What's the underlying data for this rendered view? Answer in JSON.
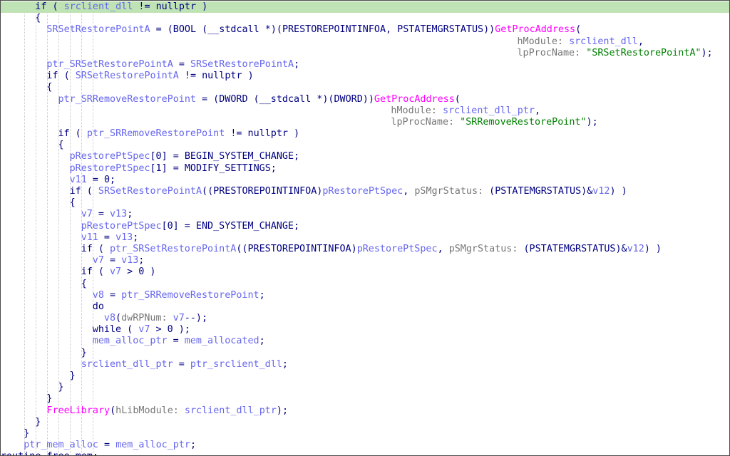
{
  "theme": {
    "highlight_bg": "#bfe3b4",
    "plain": "#000080",
    "var": "#6666ee",
    "func": "#ff00ff",
    "str": "#008000",
    "param_label": "#777777"
  },
  "code": {
    "highlighted_line": 0,
    "lines": [
      {
        "indent": 6,
        "tokens": [
          {
            "t": "k",
            "x": "if ( "
          },
          {
            "t": "v",
            "x": "srclient_dll"
          },
          {
            "t": "p",
            "x": " != nullptr )"
          }
        ]
      },
      {
        "indent": 6,
        "tokens": [
          {
            "t": "p",
            "x": "{"
          }
        ]
      },
      {
        "indent": 8,
        "tokens": [
          {
            "t": "v",
            "x": "SRSetRestorePointA"
          },
          {
            "t": "p",
            "x": " = (BOOL (__stdcall *)(PRESTOREPOINTINFOA, PSTATEMGRSTATUS))"
          },
          {
            "t": "f",
            "x": "GetProcAddress"
          },
          {
            "t": "p",
            "x": "("
          }
        ]
      },
      {
        "indent": 90,
        "tokens": [
          {
            "t": "pl",
            "x": "hModule: "
          },
          {
            "t": "v",
            "x": "srclient_dll"
          },
          {
            "t": "p",
            "x": ","
          }
        ]
      },
      {
        "indent": 90,
        "tokens": [
          {
            "t": "pl",
            "x": "lpProcName: "
          },
          {
            "t": "s",
            "x": "\"SRSetRestorePointA\""
          },
          {
            "t": "p",
            "x": ");"
          }
        ]
      },
      {
        "indent": 8,
        "tokens": [
          {
            "t": "v",
            "x": "ptr_SRSetRestorePointA"
          },
          {
            "t": "p",
            "x": " = "
          },
          {
            "t": "v",
            "x": "SRSetRestorePointA"
          },
          {
            "t": "p",
            "x": ";"
          }
        ]
      },
      {
        "indent": 8,
        "tokens": [
          {
            "t": "k",
            "x": "if ( "
          },
          {
            "t": "v",
            "x": "SRSetRestorePointA"
          },
          {
            "t": "p",
            "x": " != nullptr )"
          }
        ]
      },
      {
        "indent": 8,
        "tokens": [
          {
            "t": "p",
            "x": "{"
          }
        ]
      },
      {
        "indent": 10,
        "tokens": [
          {
            "t": "v",
            "x": "ptr_SRRemoveRestorePoint"
          },
          {
            "t": "p",
            "x": " = (DWORD (__stdcall *)(DWORD))"
          },
          {
            "t": "f",
            "x": "GetProcAddress"
          },
          {
            "t": "p",
            "x": "("
          }
        ]
      },
      {
        "indent": 68,
        "tokens": [
          {
            "t": "pl",
            "x": "hModule: "
          },
          {
            "t": "v",
            "x": "srclient_dll_ptr"
          },
          {
            "t": "p",
            "x": ","
          }
        ]
      },
      {
        "indent": 68,
        "tokens": [
          {
            "t": "pl",
            "x": "lpProcName: "
          },
          {
            "t": "s",
            "x": "\"SRRemoveRestorePoint\""
          },
          {
            "t": "p",
            "x": ");"
          }
        ]
      },
      {
        "indent": 10,
        "tokens": [
          {
            "t": "k",
            "x": "if ( "
          },
          {
            "t": "v",
            "x": "ptr_SRRemoveRestorePoint"
          },
          {
            "t": "p",
            "x": " != nullptr )"
          }
        ]
      },
      {
        "indent": 10,
        "tokens": [
          {
            "t": "p",
            "x": "{"
          }
        ]
      },
      {
        "indent": 12,
        "tokens": [
          {
            "t": "v",
            "x": "pRestorePtSpec"
          },
          {
            "t": "p",
            "x": "[0] = BEGIN_SYSTEM_CHANGE;"
          }
        ]
      },
      {
        "indent": 12,
        "tokens": [
          {
            "t": "v",
            "x": "pRestorePtSpec"
          },
          {
            "t": "p",
            "x": "[1] = MODIFY_SETTINGS;"
          }
        ]
      },
      {
        "indent": 12,
        "tokens": [
          {
            "t": "v",
            "x": "v11"
          },
          {
            "t": "p",
            "x": " = 0;"
          }
        ]
      },
      {
        "indent": 12,
        "tokens": [
          {
            "t": "k",
            "x": "if ( "
          },
          {
            "t": "v",
            "x": "SRSetRestorePointA"
          },
          {
            "t": "p",
            "x": "((PRESTOREPOINTINFOA)"
          },
          {
            "t": "v",
            "x": "pRestorePtSpec"
          },
          {
            "t": "p",
            "x": ", "
          },
          {
            "t": "pl",
            "x": "pSMgrStatus: "
          },
          {
            "t": "p",
            "x": "(PSTATEMGRSTATUS)&"
          },
          {
            "t": "v",
            "x": "v12"
          },
          {
            "t": "p",
            "x": ") )"
          }
        ]
      },
      {
        "indent": 12,
        "tokens": [
          {
            "t": "p",
            "x": "{"
          }
        ]
      },
      {
        "indent": 14,
        "tokens": [
          {
            "t": "v",
            "x": "v7"
          },
          {
            "t": "p",
            "x": " = "
          },
          {
            "t": "v",
            "x": "v13"
          },
          {
            "t": "p",
            "x": ";"
          }
        ]
      },
      {
        "indent": 14,
        "tokens": [
          {
            "t": "v",
            "x": "pRestorePtSpec"
          },
          {
            "t": "p",
            "x": "[0] = END_SYSTEM_CHANGE;"
          }
        ]
      },
      {
        "indent": 14,
        "tokens": [
          {
            "t": "v",
            "x": "v11"
          },
          {
            "t": "p",
            "x": " = "
          },
          {
            "t": "v",
            "x": "v13"
          },
          {
            "t": "p",
            "x": ";"
          }
        ]
      },
      {
        "indent": 14,
        "tokens": [
          {
            "t": "k",
            "x": "if ( "
          },
          {
            "t": "v",
            "x": "ptr_SRSetRestorePointA"
          },
          {
            "t": "p",
            "x": "((PRESTOREPOINTINFOA)"
          },
          {
            "t": "v",
            "x": "pRestorePtSpec"
          },
          {
            "t": "p",
            "x": ", "
          },
          {
            "t": "pl",
            "x": "pSMgrStatus: "
          },
          {
            "t": "p",
            "x": "(PSTATEMGRSTATUS)&"
          },
          {
            "t": "v",
            "x": "v12"
          },
          {
            "t": "p",
            "x": ") )"
          }
        ]
      },
      {
        "indent": 16,
        "tokens": [
          {
            "t": "v",
            "x": "v7"
          },
          {
            "t": "p",
            "x": " = "
          },
          {
            "t": "v",
            "x": "v13"
          },
          {
            "t": "p",
            "x": ";"
          }
        ]
      },
      {
        "indent": 14,
        "tokens": [
          {
            "t": "k",
            "x": "if ( "
          },
          {
            "t": "v",
            "x": "v7"
          },
          {
            "t": "p",
            "x": " > 0 )"
          }
        ]
      },
      {
        "indent": 14,
        "tokens": [
          {
            "t": "p",
            "x": "{"
          }
        ]
      },
      {
        "indent": 16,
        "tokens": [
          {
            "t": "v",
            "x": "v8"
          },
          {
            "t": "p",
            "x": " = "
          },
          {
            "t": "v",
            "x": "ptr_SRRemoveRestorePoint"
          },
          {
            "t": "p",
            "x": ";"
          }
        ]
      },
      {
        "indent": 16,
        "tokens": [
          {
            "t": "k",
            "x": "do"
          }
        ]
      },
      {
        "indent": 18,
        "tokens": [
          {
            "t": "v",
            "x": "v8"
          },
          {
            "t": "p",
            "x": "("
          },
          {
            "t": "pl",
            "x": "dwRPNum: "
          },
          {
            "t": "v",
            "x": "v7"
          },
          {
            "t": "p",
            "x": "--);"
          }
        ]
      },
      {
        "indent": 16,
        "tokens": [
          {
            "t": "k",
            "x": "while ( "
          },
          {
            "t": "v",
            "x": "v7"
          },
          {
            "t": "p",
            "x": " > 0 );"
          }
        ]
      },
      {
        "indent": 16,
        "tokens": [
          {
            "t": "v",
            "x": "mem_alloc_ptr"
          },
          {
            "t": "p",
            "x": " = "
          },
          {
            "t": "v",
            "x": "mem_allocated"
          },
          {
            "t": "p",
            "x": ";"
          }
        ]
      },
      {
        "indent": 14,
        "tokens": [
          {
            "t": "p",
            "x": "}"
          }
        ]
      },
      {
        "indent": 14,
        "tokens": [
          {
            "t": "v",
            "x": "srclient_dll_ptr"
          },
          {
            "t": "p",
            "x": " = "
          },
          {
            "t": "v",
            "x": "ptr_srclient_dll"
          },
          {
            "t": "p",
            "x": ";"
          }
        ]
      },
      {
        "indent": 12,
        "tokens": [
          {
            "t": "p",
            "x": "}"
          }
        ]
      },
      {
        "indent": 10,
        "tokens": [
          {
            "t": "p",
            "x": "}"
          }
        ]
      },
      {
        "indent": 8,
        "tokens": [
          {
            "t": "p",
            "x": "}"
          }
        ]
      },
      {
        "indent": 8,
        "tokens": [
          {
            "t": "f",
            "x": "FreeLibrary"
          },
          {
            "t": "p",
            "x": "("
          },
          {
            "t": "pl",
            "x": "hLibModule: "
          },
          {
            "t": "v",
            "x": "srclient_dll_ptr"
          },
          {
            "t": "p",
            "x": ");"
          }
        ]
      },
      {
        "indent": 6,
        "tokens": [
          {
            "t": "p",
            "x": "}"
          }
        ]
      },
      {
        "indent": 4,
        "tokens": [
          {
            "t": "p",
            "x": "}"
          }
        ]
      },
      {
        "indent": 4,
        "tokens": [
          {
            "t": "v",
            "x": "ptr_mem_alloc"
          },
          {
            "t": "p",
            "x": " = "
          },
          {
            "t": "v",
            "x": "mem_alloc_ptr"
          },
          {
            "t": "p",
            "x": ";"
          }
        ]
      },
      {
        "indent": 0,
        "tokens": [
          {
            "t": "p",
            "x": "routine_free_mem:"
          }
        ]
      }
    ]
  }
}
